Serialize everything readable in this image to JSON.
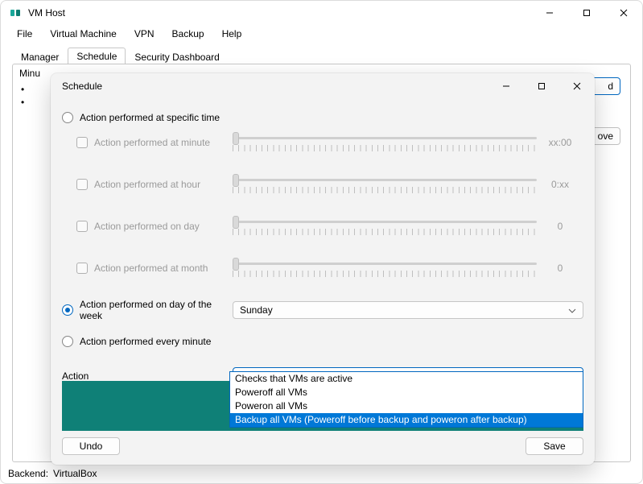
{
  "app": {
    "title": "VM Host"
  },
  "menu": {
    "items": [
      "File",
      "Virtual Machine",
      "VPN",
      "Backup",
      "Help"
    ]
  },
  "tabs": {
    "items": [
      "Manager",
      "Schedule",
      "Security Dashboard"
    ],
    "active": 1
  },
  "bg": {
    "peek": "Minu",
    "buttons": {
      "add_tail": "d",
      "remove_tail": "ove"
    }
  },
  "dialog": {
    "title": "Schedule",
    "rows": {
      "specific_time": {
        "label": "Action performed at specific time",
        "checked": false
      },
      "minute": {
        "label": "Action performed at minute",
        "value_label": "xx:00"
      },
      "hour": {
        "label": "Action performed at hour",
        "value_label": "0:xx"
      },
      "day": {
        "label": "Action performed on day",
        "value_label": "0"
      },
      "month": {
        "label": "Action performed at month",
        "value_label": "0"
      },
      "dow": {
        "label": "Action performed on day of the week",
        "checked": true,
        "value": "Sunday"
      },
      "every": {
        "label": "Action performed every minute",
        "checked": false
      },
      "action_label": "Action"
    },
    "action_options": [
      "Checks that VMs are active",
      "Poweroff all VMs",
      "Poweron all VMs",
      "Backup all VMs (Poweroff before backup and poweron after backup)"
    ],
    "action_selected_index": 3,
    "buttons": {
      "undo": "Undo",
      "save": "Save"
    }
  },
  "status": {
    "label": "Backend:",
    "value": "VirtualBox"
  }
}
